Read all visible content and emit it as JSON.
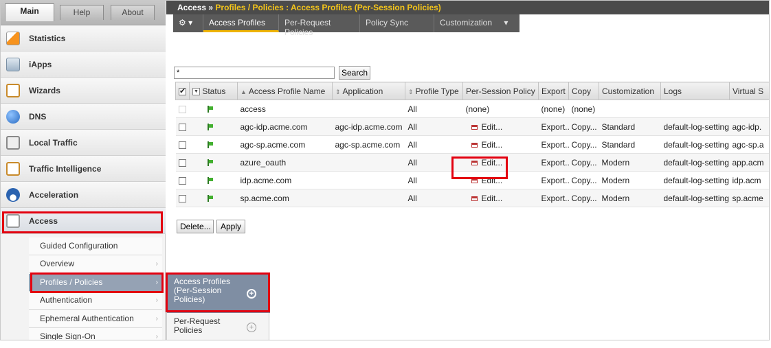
{
  "top_tabs": {
    "main": "Main",
    "help": "Help",
    "about": "About"
  },
  "nav": [
    {
      "label": "Statistics",
      "icon": "statistics-icon"
    },
    {
      "label": "iApps",
      "icon": "iapps-icon"
    },
    {
      "label": "Wizards",
      "icon": "wizards-icon"
    },
    {
      "label": "DNS",
      "icon": "dns-globe-icon"
    },
    {
      "label": "Local Traffic",
      "icon": "local-traffic-icon"
    },
    {
      "label": "Traffic Intelligence",
      "icon": "traffic-intelligence-icon"
    },
    {
      "label": "Acceleration",
      "icon": "acceleration-gauge-icon"
    },
    {
      "label": "Access",
      "icon": "access-icon"
    }
  ],
  "access_submenu": [
    "Guided Configuration",
    "Overview",
    "Profiles / Policies",
    "Authentication",
    "Ephemeral Authentication",
    "Single Sign-On"
  ],
  "flyout": {
    "item1": {
      "line1": "Access Profiles",
      "line2": "(Per-Session",
      "line3": "Policies)"
    },
    "item2": {
      "line1": "Per-Request",
      "line2": "Policies"
    },
    "plus": "+"
  },
  "breadcrumb": {
    "section": "Access",
    "separator": "»",
    "path": "Profiles / Policies : Access Profiles (Per-Session Policies)"
  },
  "tabs": {
    "gear": "⚙ ▾",
    "items": [
      "Access Profiles",
      "Per-Request Policies",
      "Policy Sync",
      "Customization"
    ],
    "dropdown_caret": "▾"
  },
  "search": {
    "value": "*",
    "button": "Search"
  },
  "table": {
    "headers": {
      "status": "Status",
      "name": "Access Profile Name",
      "application": "Application",
      "profile_type": "Profile Type",
      "per_session_policy": "Per-Session Policy",
      "export": "Export",
      "copy": "Copy",
      "customization": "Customization",
      "logs": "Logs",
      "virtual_servers": "Virtual S"
    },
    "sort_up": "▲",
    "sort_both": "⇕",
    "rows": [
      {
        "name": "access",
        "application": "",
        "type": "All",
        "policy": "(none)",
        "export": "(none)",
        "copy": "(none)",
        "customization": "",
        "logs": "",
        "virtual": ""
      },
      {
        "name": "agc-idp.acme.com",
        "application": "agc-idp.acme.com",
        "type": "All",
        "policy": "Edit...",
        "export": "Export...",
        "copy": "Copy...",
        "customization": "Standard",
        "logs": "default-log-setting",
        "virtual": "agc-idp."
      },
      {
        "name": "agc-sp.acme.com",
        "application": "agc-sp.acme.com",
        "type": "All",
        "policy": "Edit...",
        "export": "Export...",
        "copy": "Copy...",
        "customization": "Standard",
        "logs": "default-log-setting",
        "virtual": "agc-sp.a"
      },
      {
        "name": "azure_oauth",
        "application": "",
        "type": "All",
        "policy": "Edit...",
        "export": "Export...",
        "copy": "Copy...",
        "customization": "Modern",
        "logs": "default-log-setting",
        "virtual": "app.acm"
      },
      {
        "name": "idp.acme.com",
        "application": "",
        "type": "All",
        "policy": "Edit...",
        "export": "Export...",
        "copy": "Copy...",
        "customization": "Modern",
        "logs": "default-log-setting",
        "virtual": "idp.acm"
      },
      {
        "name": "sp.acme.com",
        "application": "",
        "type": "All",
        "policy": "Edit...",
        "export": "Export...",
        "copy": "Copy...",
        "customization": "Modern",
        "logs": "default-log-setting",
        "virtual": "sp.acme"
      }
    ]
  },
  "actions": {
    "delete": "Delete...",
    "apply": "Apply"
  },
  "colors": {
    "highlight": "#e3000f",
    "breadcrumb_accent": "#f4c51a",
    "tab_underline": "#f0b400",
    "link": "#2b5d9e",
    "status_green": "#42b02f"
  }
}
